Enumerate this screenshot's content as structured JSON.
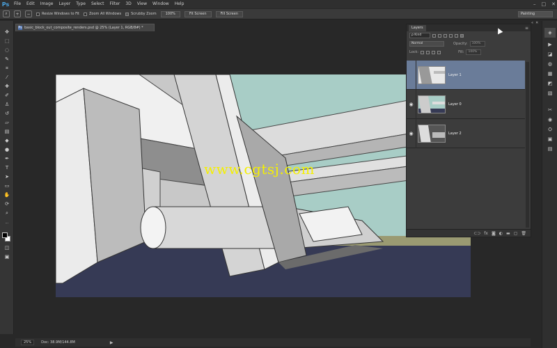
{
  "app": {
    "logo": "Ps"
  },
  "menu": [
    "File",
    "Edit",
    "Image",
    "Layer",
    "Type",
    "Select",
    "Filter",
    "3D",
    "View",
    "Window",
    "Help"
  ],
  "window_controls": {
    "minimize": "–",
    "maximize": "□",
    "close": "✕"
  },
  "options": {
    "resize_windows_label": "Resize Windows to Fit",
    "zoom_all_label": "Zoom All Windows",
    "scrubby_label": "Scrubby Zoom",
    "btn_100": "100%",
    "btn_fit": "Fit Screen",
    "btn_fill": "Fill Screen",
    "workspace": "Painting"
  },
  "document": {
    "tab_title": "basic_block_out_composite_renders.psd @ 25% (Layer 1, RGB/8#) *"
  },
  "watermark": "www.cgtsj.com",
  "status": {
    "zoom": "25%",
    "doc": "Doc: 38.9M/144.8M",
    "arrow": "▶"
  },
  "layers_panel": {
    "tab_label": "Layers",
    "kind_label": "ρ Kind",
    "blend_mode": "Normal",
    "opacity_label": "Opacity:",
    "opacity_value": "100%",
    "lock_label": "Lock:",
    "fill_label": "Fill:",
    "fill_value": "100%",
    "layers": [
      {
        "name": "Layer 1",
        "visible": false,
        "active": true
      },
      {
        "name": "Layer 0",
        "visible": true,
        "active": false
      },
      {
        "name": "Layer 2",
        "visible": true,
        "active": false
      }
    ]
  },
  "colors": {
    "accent": "#4aa3e0",
    "active_layer": "#6a7c99",
    "sky": "#9fc7c1",
    "ground": "#363a55",
    "watermark": "#f5f000"
  }
}
